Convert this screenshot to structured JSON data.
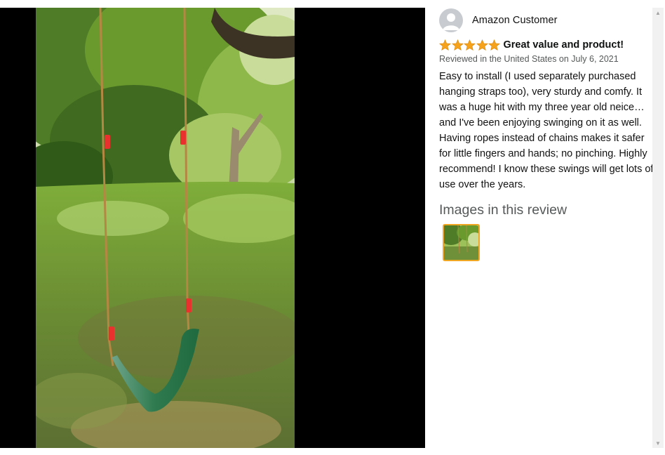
{
  "review": {
    "reviewer_name": "Amazon Customer",
    "rating_stars": 5,
    "rating_max": 5,
    "title": "Great value and product!",
    "meta": "Reviewed in the United States on July 6, 2021",
    "body": "Easy to install (I used separately purchased hanging straps too), very sturdy and comfy. It was a huge hit with my three year old neice…and I've been enjoying swinging on it as well. Having ropes instead of chains makes it safer for little fingers and hands; no pinching. Highly recommend! I know these swings will get lots of use over the years.",
    "images_heading": "Images in this review",
    "image_count": 1
  },
  "colors": {
    "star": "#f7a21b",
    "thumb_border": "#f0a824",
    "viewer_bg": "#000000",
    "meta_text": "#565959"
  },
  "icons": {
    "avatar": "person-icon",
    "star": "star-icon",
    "scroll_up": "triangle-up-icon",
    "scroll_down": "triangle-down-icon"
  }
}
